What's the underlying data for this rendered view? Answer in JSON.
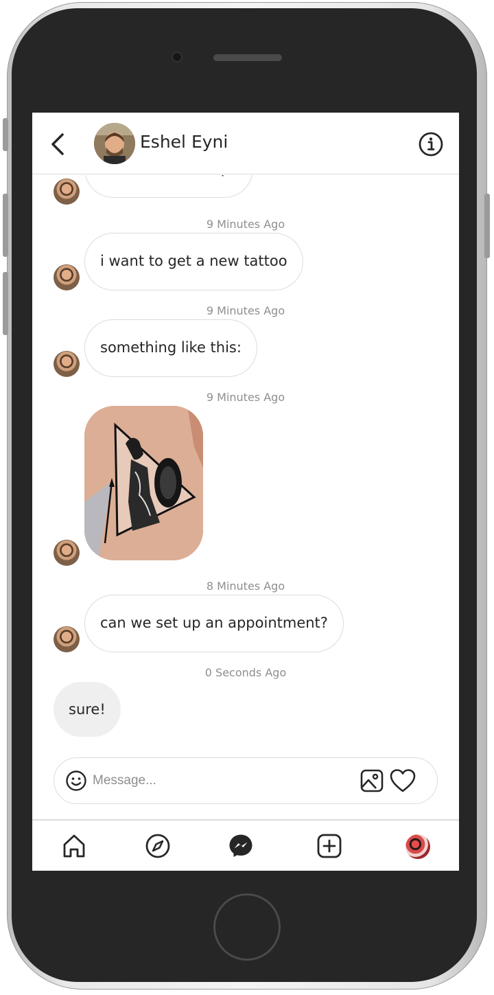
{
  "header": {
    "contact_name": "Eshel Eyni"
  },
  "messages": [
    {
      "text": "Hi kate, what's up?",
      "from": "them"
    },
    {
      "timestamp": "9 Minutes Ago",
      "text": "i want to get a new tattoo",
      "from": "them"
    },
    {
      "timestamp": "9 Minutes Ago",
      "text": "something like this:",
      "from": "them"
    },
    {
      "timestamp": "9 Minutes Ago",
      "image": "tattoo-photo",
      "from": "them"
    },
    {
      "timestamp": "8 Minutes Ago",
      "text": "can we set up an appointment?",
      "from": "them"
    },
    {
      "timestamp": "0 Seconds Ago",
      "text": "sure!",
      "from": "me"
    }
  ],
  "composer": {
    "placeholder": "Message..."
  },
  "icons": {
    "back": "chevron-left-icon",
    "info": "info-icon",
    "emoji": "smiley-icon",
    "image": "image-icon",
    "like": "heart-icon",
    "nav": [
      "home-icon",
      "compass-icon",
      "messenger-icon",
      "plus-square-icon",
      "profile-avatar"
    ]
  },
  "colors": {
    "border": "#dbdbdb",
    "text": "#262626",
    "muted": "#8e8e8e",
    "own_bubble": "#efefef",
    "frame": "#262626"
  }
}
